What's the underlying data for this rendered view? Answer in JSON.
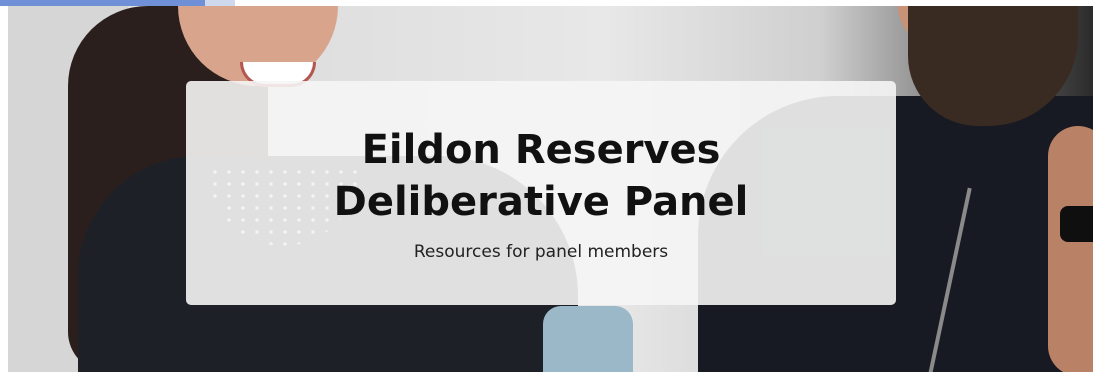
{
  "hero": {
    "title": "Eildon Reserves Deliberative Panel",
    "subtitle": "Resources for panel members",
    "overlay_color": "#f5f5f5",
    "accent_color": "#6f8fd6"
  }
}
